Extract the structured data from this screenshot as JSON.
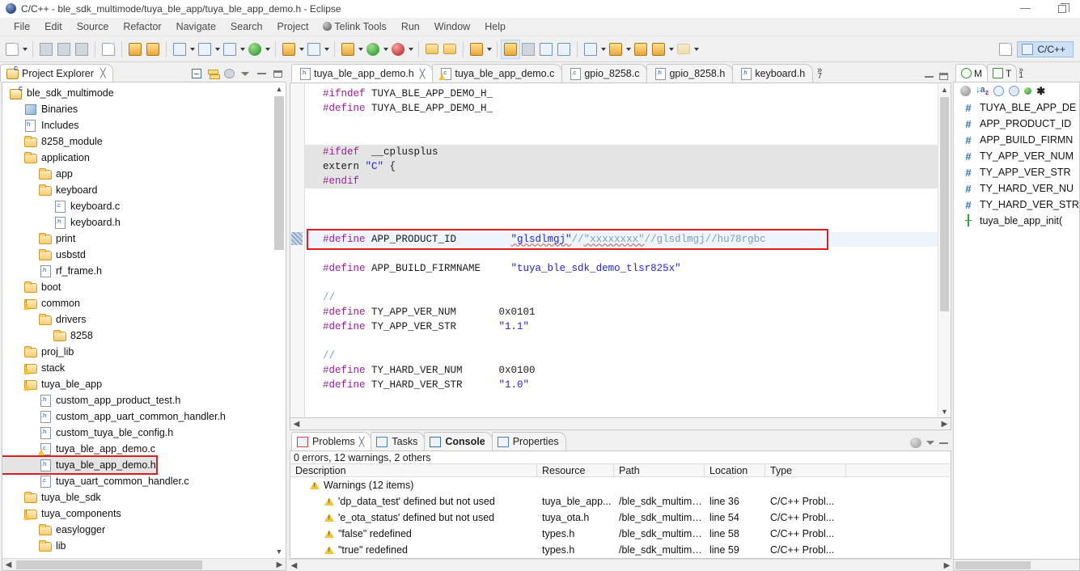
{
  "window": {
    "title": "C/C++ - ble_sdk_multimode/tuya_ble_app/tuya_ble_app_demo.h - Eclipse",
    "minimize_label": "–",
    "restore_label": "❐"
  },
  "menubar": [
    {
      "label": "File"
    },
    {
      "label": "Edit"
    },
    {
      "label": "Source"
    },
    {
      "label": "Refactor"
    },
    {
      "label": "Navigate"
    },
    {
      "label": "Search"
    },
    {
      "label": "Project"
    },
    {
      "label": "Telink Tools"
    },
    {
      "label": "Run"
    },
    {
      "label": "Window"
    },
    {
      "label": "Help"
    }
  ],
  "toolbar": {
    "perspective_label": "C/C++",
    "items": [
      {
        "name": "new-wizard",
        "dropdown": true
      },
      {
        "name": "save",
        "dropdown": false
      },
      {
        "name": "save-all",
        "dropdown": false
      },
      {
        "name": "print",
        "dropdown": false
      },
      {
        "name": "binary-view",
        "dropdown": false
      },
      {
        "name": "build-all",
        "dropdown": false
      },
      {
        "name": "debug-bug",
        "dropdown": false
      },
      {
        "name": "new-c-project",
        "dropdown": true
      },
      {
        "name": "new-cpp-project",
        "dropdown": true
      },
      {
        "name": "new-c-class",
        "dropdown": true
      },
      {
        "name": "new-target",
        "dropdown": true
      },
      {
        "name": "build-hammer",
        "dropdown": true
      },
      {
        "name": "clean",
        "dropdown": true
      },
      {
        "name": "debug",
        "dropdown": true
      },
      {
        "name": "run",
        "dropdown": true
      },
      {
        "name": "external-tools",
        "dropdown": true
      },
      {
        "name": "open-folder",
        "dropdown": false
      },
      {
        "name": "open-folder-2",
        "dropdown": false
      },
      {
        "name": "search-pen",
        "dropdown": true
      },
      {
        "name": "marker",
        "dropdown": false
      },
      {
        "name": "toggle-block",
        "dropdown": false
      },
      {
        "name": "show-whitespace",
        "dropdown": false
      },
      {
        "name": "pilcrow",
        "dropdown": false
      },
      {
        "name": "next-annotation",
        "dropdown": true
      },
      {
        "name": "prev-annotation",
        "dropdown": true
      },
      {
        "name": "last-edit",
        "dropdown": false
      },
      {
        "name": "back",
        "dropdown": true
      },
      {
        "name": "forward",
        "dropdown": true
      }
    ]
  },
  "explorer": {
    "tab_label": "Project Explorer",
    "close_glyph": "╳",
    "tree": [
      {
        "label": "ble_sdk_multimode",
        "indent": 0,
        "icon": "project-icon"
      },
      {
        "label": "Binaries",
        "indent": 1,
        "icon": "binaries-icon"
      },
      {
        "label": "Includes",
        "indent": 1,
        "icon": "includes-icon"
      },
      {
        "label": "8258_module",
        "indent": 1,
        "icon": "folder-icon"
      },
      {
        "label": "application",
        "indent": 1,
        "icon": "folder-icon"
      },
      {
        "label": "app",
        "indent": 2,
        "icon": "folder-icon"
      },
      {
        "label": "keyboard",
        "indent": 2,
        "icon": "folder-icon"
      },
      {
        "label": "keyboard.c",
        "indent": 3,
        "icon": "c-file-icon"
      },
      {
        "label": "keyboard.h",
        "indent": 3,
        "icon": "h-file-icon"
      },
      {
        "label": "print",
        "indent": 2,
        "icon": "folder-icon"
      },
      {
        "label": "usbstd",
        "indent": 2,
        "icon": "folder-icon"
      },
      {
        "label": "rf_frame.h",
        "indent": 2,
        "icon": "h-file-icon"
      },
      {
        "label": "boot",
        "indent": 1,
        "icon": "folder-icon"
      },
      {
        "label": "common",
        "indent": 1,
        "icon": "folder-warning-icon"
      },
      {
        "label": "drivers",
        "indent": 2,
        "icon": "folder-icon"
      },
      {
        "label": "8258",
        "indent": 3,
        "icon": "folder-icon"
      },
      {
        "label": "proj_lib",
        "indent": 1,
        "icon": "folder-icon"
      },
      {
        "label": "stack",
        "indent": 1,
        "icon": "folder-warning-icon"
      },
      {
        "label": "tuya_ble_app",
        "indent": 1,
        "icon": "folder-warning-icon"
      },
      {
        "label": "custom_app_product_test.h",
        "indent": 2,
        "icon": "h-file-icon"
      },
      {
        "label": "custom_app_uart_common_handler.h",
        "indent": 2,
        "icon": "h-file-icon"
      },
      {
        "label": "custom_tuya_ble_config.h",
        "indent": 2,
        "icon": "h-file-icon"
      },
      {
        "label": "tuya_ble_app_demo.c",
        "indent": 2,
        "icon": "c-file-warning-icon"
      },
      {
        "label": "tuya_ble_app_demo.h",
        "indent": 2,
        "icon": "h-file-icon",
        "selected": true,
        "highlighted": true
      },
      {
        "label": "tuya_uart_common_handler.c",
        "indent": 2,
        "icon": "c-file-icon"
      },
      {
        "label": "tuya_ble_sdk",
        "indent": 1,
        "icon": "folder-icon"
      },
      {
        "label": "tuya_components",
        "indent": 1,
        "icon": "folder-warning-icon"
      },
      {
        "label": "easylogger",
        "indent": 2,
        "icon": "folder-icon"
      },
      {
        "label": "lib",
        "indent": 2,
        "icon": "folder-icon"
      }
    ]
  },
  "editor": {
    "tabs": [
      {
        "label": "tuya_ble_app_demo.h",
        "icon": "h-file-icon",
        "active": true,
        "closable": true
      },
      {
        "label": "tuya_ble_app_demo.c",
        "icon": "c-file-warning-icon",
        "active": false
      },
      {
        "label": "gpio_8258.c",
        "icon": "c-file-icon",
        "active": false
      },
      {
        "label": "gpio_8258.h",
        "icon": "h-file-icon",
        "active": false
      },
      {
        "label": "keyboard.h",
        "icon": "h-file-icon",
        "active": false
      }
    ],
    "more_tabs_glyph": "»",
    "more_tabs_count": "7",
    "lines": [
      {
        "segments": [
          {
            "t": "#ifndef",
            "c": "k-pre"
          },
          {
            "t": " TUYA_BLE_APP_DEMO_H_",
            "c": "k-id"
          }
        ]
      },
      {
        "segments": [
          {
            "t": "#define",
            "c": "k-pre"
          },
          {
            "t": " TUYA_BLE_APP_DEMO_H_",
            "c": "k-id"
          }
        ]
      },
      {
        "segments": []
      },
      {
        "segments": []
      },
      {
        "shade": true,
        "segments": [
          {
            "t": "#ifdef",
            "c": "k-pre"
          },
          {
            "t": "  __cplusplus",
            "c": "k-id"
          }
        ]
      },
      {
        "shade": true,
        "segments": [
          {
            "t": "extern ",
            "c": "k-id"
          },
          {
            "t": "\"C\"",
            "c": "k-str"
          },
          {
            "t": " {",
            "c": "k-id"
          }
        ]
      },
      {
        "shade": true,
        "segments": [
          {
            "t": "#endif",
            "c": "k-pre"
          }
        ]
      },
      {
        "segments": []
      },
      {
        "segments": []
      },
      {
        "segments": []
      },
      {
        "cur": true,
        "marked": true,
        "segments": [
          {
            "t": "#define",
            "c": "k-pre"
          },
          {
            "t": " APP_PRODUCT_ID         ",
            "c": "k-id"
          },
          {
            "t": "\"glsdlmgj\"",
            "c": "k-str",
            "spell": true
          },
          {
            "t": "//",
            "c": "k-cmt"
          },
          {
            "t": "\"xxxxxxxx\"",
            "c": "k-cmt",
            "spell": true
          },
          {
            "t": "//glsdlmgj//hu78rgbc",
            "c": "k-cmt"
          }
        ]
      },
      {
        "segments": []
      },
      {
        "segments": [
          {
            "t": "#define",
            "c": "k-pre"
          },
          {
            "t": " APP_BUILD_FIRMNAME     ",
            "c": "k-id"
          },
          {
            "t": "\"tuya_ble_sdk_demo_tlsr825x\"",
            "c": "k-str"
          }
        ]
      },
      {
        "segments": []
      },
      {
        "segments": [
          {
            "t": "//",
            "c": "k-cmt"
          }
        ]
      },
      {
        "segments": [
          {
            "t": "#define",
            "c": "k-pre"
          },
          {
            "t": " TY_APP_VER_NUM       0x0101",
            "c": "k-id"
          }
        ]
      },
      {
        "segments": [
          {
            "t": "#define",
            "c": "k-pre"
          },
          {
            "t": " TY_APP_VER_STR       ",
            "c": "k-id"
          },
          {
            "t": "\"1.1\"",
            "c": "k-str"
          }
        ]
      },
      {
        "segments": []
      },
      {
        "segments": [
          {
            "t": "//",
            "c": "k-cmt"
          }
        ]
      },
      {
        "segments": [
          {
            "t": "#define",
            "c": "k-pre"
          },
          {
            "t": " TY_HARD_VER_NUM      0x0100",
            "c": "k-id"
          }
        ]
      },
      {
        "segments": [
          {
            "t": "#define",
            "c": "k-pre"
          },
          {
            "t": " TY_HARD_VER_STR      ",
            "c": "k-id"
          },
          {
            "t": "\"1.0\"",
            "c": "k-str"
          }
        ]
      }
    ]
  },
  "outline": {
    "tabs": [
      {
        "label": "M",
        "icon": "make-target-icon",
        "active": true
      },
      {
        "label": "T",
        "icon": "task-list-icon",
        "active": false
      }
    ],
    "more_glyph": "»",
    "more_count": "1",
    "toolbar_icons": [
      "focus-active-task-icon",
      "sort-az-icon",
      "hide-fields-icon",
      "hide-static-icon",
      "hide-nonpublic-icon",
      "hash-filter-icon"
    ],
    "items": [
      {
        "label": "TUYA_BLE_APP_DE",
        "kind": "macro"
      },
      {
        "label": "APP_PRODUCT_ID",
        "kind": "macro"
      },
      {
        "label": "APP_BUILD_FIRMN",
        "kind": "macro"
      },
      {
        "label": "TY_APP_VER_NUM",
        "kind": "macro"
      },
      {
        "label": "TY_APP_VER_STR",
        "kind": "macro"
      },
      {
        "label": "TY_HARD_VER_NU",
        "kind": "macro"
      },
      {
        "label": "TY_HARD_VER_STR",
        "kind": "macro"
      },
      {
        "label": "tuya_ble_app_init(",
        "kind": "function"
      }
    ]
  },
  "bottom_panel": {
    "tabs": [
      {
        "label": "Problems",
        "icon": "problems-icon",
        "active": true,
        "closable": true
      },
      {
        "label": "Tasks",
        "icon": "tasks-icon",
        "active": false
      },
      {
        "label": "Console",
        "icon": "console-icon",
        "active": false,
        "bold": true
      },
      {
        "label": "Properties",
        "icon": "properties-icon",
        "active": false
      }
    ],
    "summary": "0 errors, 12 warnings, 2 others",
    "columns": [
      "Description",
      "Resource",
      "Path",
      "Location",
      "Type"
    ],
    "rows": [
      {
        "indent": 1,
        "icon": "warning-icon",
        "cells": [
          "Warnings (12 items)",
          "",
          "",
          "",
          ""
        ]
      },
      {
        "indent": 2,
        "icon": "warning-icon",
        "cells": [
          "'dp_data_test' defined but not used",
          "tuya_ble_app...",
          "/ble_sdk_multimo...",
          "line 36",
          "C/C++ Probl..."
        ]
      },
      {
        "indent": 2,
        "icon": "warning-icon",
        "cells": [
          "'e_ota_status' defined but not used",
          "tuya_ota.h",
          "/ble_sdk_multimo...",
          "line 54",
          "C/C++ Probl..."
        ]
      },
      {
        "indent": 2,
        "icon": "warning-icon",
        "cells": [
          "\"false\" redefined",
          "types.h",
          "/ble_sdk_multimo...",
          "line 58",
          "C/C++ Probl..."
        ]
      },
      {
        "indent": 2,
        "icon": "warning-icon",
        "cells": [
          "\"true\" redefined",
          "types.h",
          "/ble_sdk_multimo...",
          "line 59",
          "C/C++ Probl..."
        ]
      }
    ]
  },
  "colors": {
    "highlight_red": "#d91f1f",
    "accent_blue": "#cde0f5",
    "selection_gray": "#e4e4e4",
    "string_blue": "#2424d6",
    "preproc_purple": "#9b1d9b",
    "comment_gray": "#7f9fb0"
  }
}
